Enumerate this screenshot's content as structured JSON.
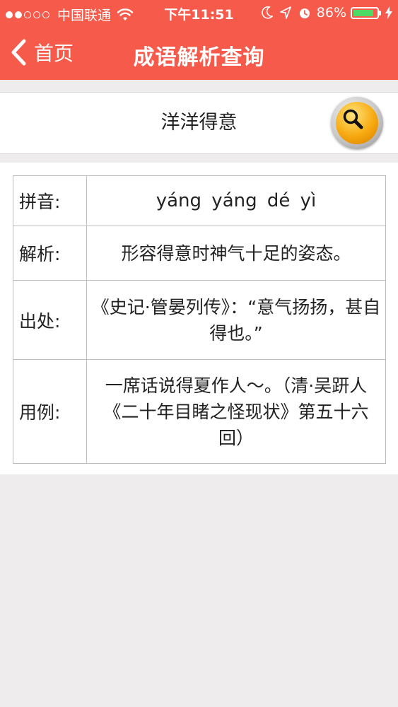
{
  "status_bar": {
    "carrier": "中国联通",
    "time": "下午11:51",
    "battery_percent": "86%",
    "battery_level": 0.86,
    "signal_bars": 2,
    "icons": [
      "wifi-icon",
      "moon-icon",
      "location-icon",
      "alarm-icon",
      "battery-icon",
      "charging-icon"
    ]
  },
  "nav": {
    "back_label": "首页",
    "title": "成语解析查询"
  },
  "search": {
    "value": "洋洋得意",
    "button_icon": "search-icon"
  },
  "result": {
    "rows": [
      {
        "label": "拼音:",
        "value": "yáng yáng dé yì"
      },
      {
        "label": "解析:",
        "value": "形容得意时神气十足的姿态。"
      },
      {
        "label": "出处:",
        "value": "《史记·管晏列传》：“意气扬扬，甚自得也。”"
      },
      {
        "label": "用例:",
        "value": "一席话说得夏作人～。（清·吴趼人《二十年目睹之怪现状》第五十六回）"
      }
    ]
  },
  "colors": {
    "header_red": "#f65a4a",
    "page_bg": "#eeecec",
    "battery_green": "#4cd964",
    "search_orange": "#f7a90f"
  }
}
